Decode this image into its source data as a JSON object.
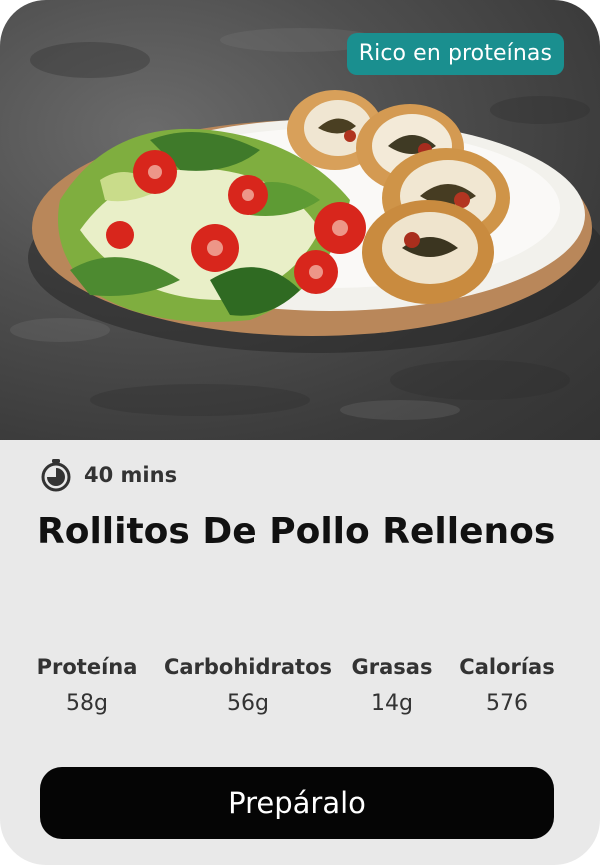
{
  "badge": {
    "label": "Rico en proteínas",
    "color": "#1a8f8f"
  },
  "recipe": {
    "time_icon": "timer-icon",
    "time": "40 mins",
    "title": "Rollitos De Pollo Rellenos"
  },
  "nutrition": [
    {
      "label": "Proteína",
      "value": "58g"
    },
    {
      "label": "Carbohidratos",
      "value": "56g"
    },
    {
      "label": "Grasas",
      "value": "14g"
    },
    {
      "label": "Calorías",
      "value": "576"
    }
  ],
  "cta": {
    "label": "Prepáralo",
    "color": "#050505"
  }
}
